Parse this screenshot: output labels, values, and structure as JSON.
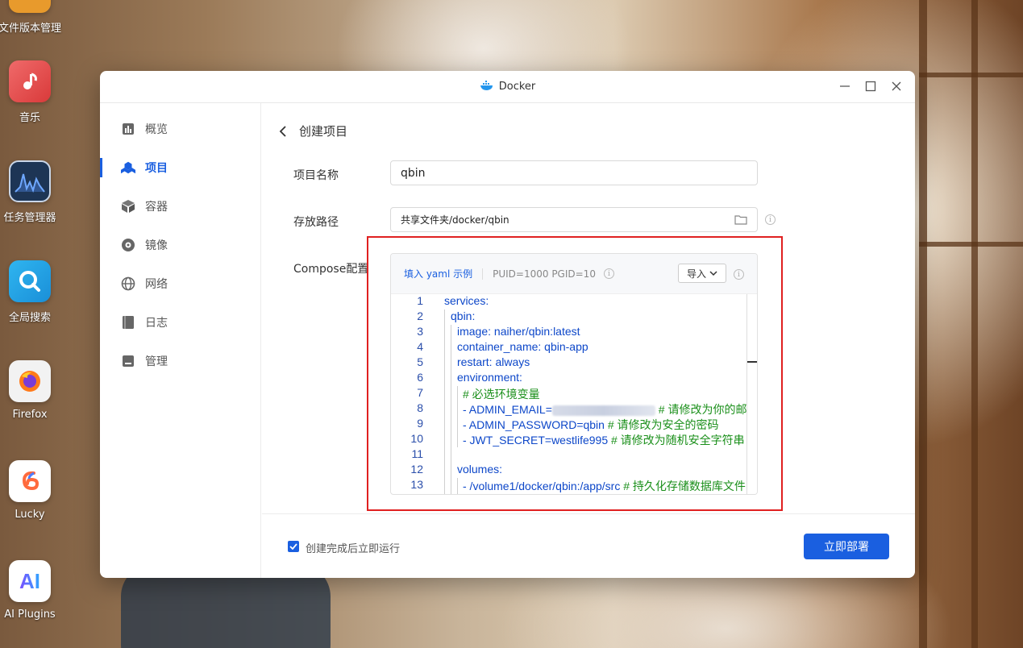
{
  "desktop": {
    "items": [
      {
        "label": "文件版本管理",
        "icon": "file-version-icon"
      },
      {
        "label": "音乐",
        "icon": "music-icon"
      },
      {
        "label": "任务管理器",
        "icon": "task-manager-icon"
      },
      {
        "label": "全局搜索",
        "icon": "search-icon"
      },
      {
        "label": "Firefox",
        "icon": "firefox-icon"
      },
      {
        "label": "Lucky",
        "icon": "lucky-icon"
      },
      {
        "label": "AI Plugins",
        "icon": "ai-plugins-icon"
      }
    ]
  },
  "window": {
    "title": "Docker",
    "controls": [
      "minimize",
      "maximize",
      "close"
    ]
  },
  "sidebar": {
    "items": [
      {
        "label": "概览",
        "icon": "overview-icon",
        "active": false
      },
      {
        "label": "项目",
        "icon": "project-icon",
        "active": true
      },
      {
        "label": "容器",
        "icon": "container-icon",
        "active": false
      },
      {
        "label": "镜像",
        "icon": "image-icon",
        "active": false
      },
      {
        "label": "网络",
        "icon": "network-icon",
        "active": false
      },
      {
        "label": "日志",
        "icon": "log-icon",
        "active": false
      },
      {
        "label": "管理",
        "icon": "manage-icon",
        "active": false
      }
    ]
  },
  "main": {
    "header": "创建项目",
    "project_name": {
      "label": "项目名称",
      "value": "qbin"
    },
    "storage_path": {
      "label": "存放路径",
      "value": "共享文件夹/docker/qbin"
    },
    "compose": {
      "label": "Compose配置",
      "fill_yaml_link": "填入 yaml 示例",
      "puid_text": "PUID=1000 PGID=10",
      "import_label": "导入"
    }
  },
  "editor": {
    "lines": [
      {
        "n": "1",
        "text": "services:",
        "comment": false
      },
      {
        "n": "2",
        "text": "qbin:",
        "comment": false
      },
      {
        "n": "3",
        "text": "image: naiher/qbin:latest",
        "comment": false
      },
      {
        "n": "4",
        "text": "container_name: qbin-app",
        "comment": false
      },
      {
        "n": "5",
        "text": "restart: always",
        "comment": false
      },
      {
        "n": "6",
        "text": "environment:",
        "comment": false
      },
      {
        "n": "7",
        "text": "# 必选环境变量",
        "comment": true
      },
      {
        "n": "8",
        "text": "- ADMIN_EMAIL=",
        "comment": false,
        "redacted": true,
        "trail": " # 请修改为你的邮"
      },
      {
        "n": "9",
        "text": "- ADMIN_PASSWORD=qbin",
        "comment": false,
        "trail": " # 请修改为安全的密码"
      },
      {
        "n": "10",
        "text": "- JWT_SECRET=westlife995",
        "comment": false,
        "trail": " # 请修改为随机安全字符串"
      },
      {
        "n": "11",
        "text": "",
        "comment": false
      },
      {
        "n": "12",
        "text": "volumes:",
        "comment": false
      },
      {
        "n": "13",
        "text": "- /volume1/docker/qbin:/app/src",
        "comment": false,
        "trail": " # 持久化存储数据库文件"
      }
    ]
  },
  "footer": {
    "checkbox_label": "创建完成后立即运行",
    "checkbox_checked": true,
    "deploy_label": "立即部署"
  },
  "colors": {
    "accent": "#1a5fe0",
    "highlight_border": "#e02020",
    "code_key": "#0d47c9",
    "code_comment": "#1a8f1a"
  }
}
